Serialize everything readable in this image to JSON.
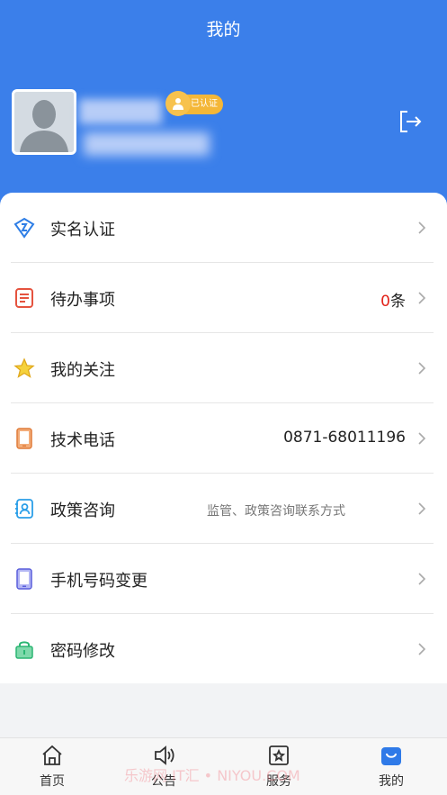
{
  "header": {
    "title": "我的",
    "verified_badge": "已认证",
    "background_color": "#3b7fea"
  },
  "menu": [
    {
      "label": "实名认证",
      "value": "",
      "icon": "shield-id-icon"
    },
    {
      "label": "待办事项",
      "value_count": "0",
      "value_unit": "条",
      "icon": "todo-list-icon"
    },
    {
      "label": "我的关注",
      "value": "",
      "icon": "star-icon"
    },
    {
      "label": "技术电话",
      "value": "0871-68011196",
      "icon": "phone-device-icon"
    },
    {
      "label": "政策咨询",
      "value": "监管、政策咨询联系方式",
      "icon": "contact-card-icon"
    },
    {
      "label": "手机号码变更",
      "value": "",
      "icon": "mobile-phone-icon"
    },
    {
      "label": "密码修改",
      "value": "",
      "icon": "lock-icon"
    }
  ],
  "tabs": [
    {
      "label": "首页",
      "icon": "home-icon"
    },
    {
      "label": "公告",
      "icon": "speaker-icon"
    },
    {
      "label": "服务",
      "icon": "service-star-icon"
    },
    {
      "label": "我的",
      "icon": "profile-bag-icon",
      "active": true
    }
  ],
  "watermark": "乐游网 IT汇 • NIYOU.COM",
  "colors": {
    "accent": "#3b7fea",
    "count_red": "#e2231a",
    "badge": "#f4b738"
  }
}
